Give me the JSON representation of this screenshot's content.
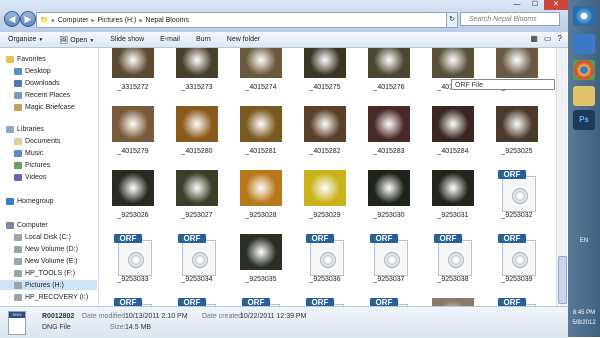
{
  "window": {
    "address": [
      "Computer",
      "Pictures (H:)",
      "Nepal Blooms"
    ],
    "search_placeholder": "Search Nepal Blooms"
  },
  "toolbar": {
    "organize": "Organize",
    "open": "Open",
    "slideshow": "Slide show",
    "email": "E-mail",
    "burn": "Burn",
    "new_folder": "New folder"
  },
  "sidebar": {
    "favorites": "Favorites",
    "desktop": "Desktop",
    "downloads": "Downloads",
    "recent": "Recent Places",
    "magic": "Magic Briefcase",
    "libraries": "Libraries",
    "documents": "Documents",
    "music": "Music",
    "pictures": "Pictures",
    "videos": "Videos",
    "homegroup": "Homegroup",
    "computer": "Computer",
    "local_c": "Local Disk (C:)",
    "vol_d": "New Volume (D:)",
    "vol_e": "New Volume (E:)",
    "hp_tools": "HP_TOOLS (F:)",
    "pictures_h": "Pictures (H:)",
    "hp_recovery": "HP_RECOVERY (I:)"
  },
  "files": [
    {
      "name": "_3315272",
      "kind": "photo",
      "color": "#5c4a30"
    },
    {
      "name": "_3315273",
      "kind": "photo",
      "color": "#4a3f2a"
    },
    {
      "name": "_4015274",
      "kind": "photo",
      "color": "#6b5a3a"
    },
    {
      "name": "_4015275",
      "kind": "photo",
      "color": "#3e3424"
    },
    {
      "name": "_4015276",
      "kind": "photo",
      "color": "#4d4530"
    },
    {
      "name": "_4015277",
      "kind": "photo",
      "color": "#5a5038"
    },
    {
      "name": "_4015278",
      "kind": "photo",
      "color": "#6a5a44"
    },
    {
      "name": "_4015279",
      "kind": "photo",
      "color": "#7a5a3a"
    },
    {
      "name": "_4015280",
      "kind": "photo",
      "color": "#8a5a1a"
    },
    {
      "name": "_4015281",
      "kind": "photo",
      "color": "#7a5a20"
    },
    {
      "name": "_4015282",
      "kind": "photo",
      "color": "#5a4028"
    },
    {
      "name": "_4015283",
      "kind": "photo",
      "color": "#4a2a24"
    },
    {
      "name": "_4015284",
      "kind": "photo",
      "color": "#3a2820"
    },
    {
      "name": "_9253025",
      "kind": "photo",
      "color": "#4a3a2a"
    },
    {
      "name": "_9253026",
      "kind": "photo",
      "color": "#2a2a22"
    },
    {
      "name": "_9253027",
      "kind": "photo",
      "color": "#3a4028"
    },
    {
      "name": "_9253028",
      "kind": "photo",
      "color": "#b8781a"
    },
    {
      "name": "_9253029",
      "kind": "photo",
      "color": "#c9b21a"
    },
    {
      "name": "_9253030",
      "kind": "photo",
      "color": "#1e241a"
    },
    {
      "name": "_9253031",
      "kind": "photo",
      "color": "#22261c"
    },
    {
      "name": "_9253032",
      "kind": "orf"
    },
    {
      "name": "_9253033",
      "kind": "orf"
    },
    {
      "name": "_9253034",
      "kind": "orf"
    },
    {
      "name": "_9253035",
      "kind": "photo",
      "color": "#2a3022"
    },
    {
      "name": "_9253036",
      "kind": "orf"
    },
    {
      "name": "_9253037",
      "kind": "orf"
    },
    {
      "name": "_9253038",
      "kind": "orf"
    },
    {
      "name": "_9253039",
      "kind": "orf"
    },
    {
      "name": "",
      "kind": "orf"
    },
    {
      "name": "",
      "kind": "orf"
    },
    {
      "name": "",
      "kind": "orf"
    },
    {
      "name": "",
      "kind": "orf"
    },
    {
      "name": "",
      "kind": "orf"
    },
    {
      "name": "",
      "kind": "photo",
      "color": "#8a7a6a"
    },
    {
      "name": "",
      "kind": "orf"
    }
  ],
  "orf_label": "ORF",
  "tooltip": "ORF File",
  "details": {
    "dng_label": "DNG",
    "filename": "R0012802",
    "filetype": "DNG File",
    "modified_label": "Date modified:",
    "modified": "10/13/2011 2:10 PM",
    "size_label": "Size:",
    "size": "14.5 MB",
    "created_label": "Date created:",
    "created": "10/22/2011 12:39 PM"
  },
  "taskbar": {
    "lang": "EN",
    "time": "8:45 PM",
    "date": "5/8/2012"
  }
}
